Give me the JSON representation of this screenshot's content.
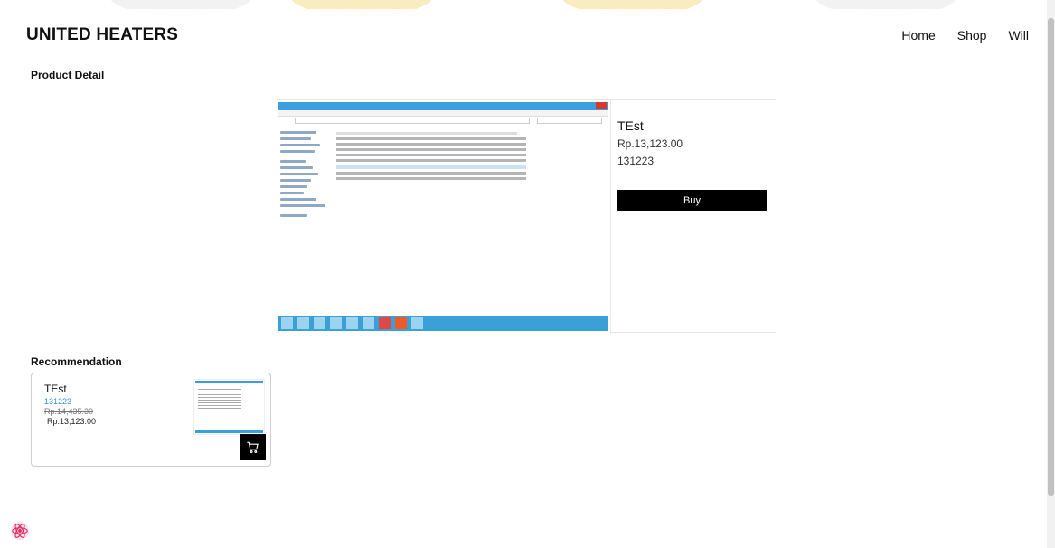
{
  "colors": {
    "accent": "#000000",
    "link": "#3b8fd9",
    "badge": "#e0245e"
  },
  "header": {
    "brand": "UNITED HEATERS",
    "nav": [
      {
        "label": "Home"
      },
      {
        "label": "Shop"
      },
      {
        "label": "Will"
      }
    ]
  },
  "detail": {
    "section_title": "Product Detail",
    "name": "TEst",
    "price": "Rp.13,123.00",
    "code": "131223",
    "buy_label": "Buy",
    "image_icon": "file-explorer-screenshot"
  },
  "recommendation": {
    "section_title": "Recommendation",
    "items": [
      {
        "name": "TEst",
        "code": "131223",
        "old_price": "Rp.14,435.30",
        "price": "Rp.13,123.00",
        "cart_icon": "cart-icon"
      }
    ]
  },
  "footer": {
    "badge_icon": "react-logo-icon"
  }
}
